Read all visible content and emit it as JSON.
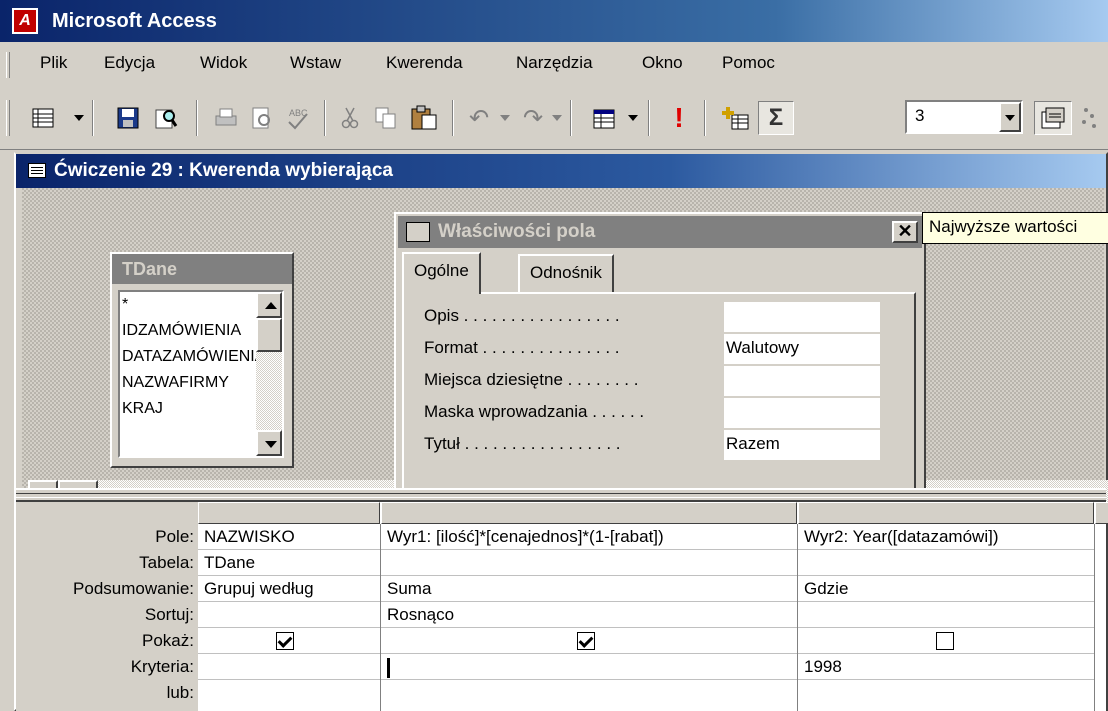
{
  "app": {
    "title": "Microsoft Access",
    "icon": "access-key-icon"
  },
  "menu": [
    "Plik",
    "Edycja",
    "Widok",
    "Wstaw",
    "Kwerenda",
    "Narzędzia",
    "Okno",
    "Pomoc"
  ],
  "toolbar": {
    "top_values_value": "3",
    "icons": [
      "view-icon",
      "save-icon",
      "search-icon",
      "print-icon",
      "print-preview-icon",
      "spelling-icon",
      "cut-icon",
      "copy-icon",
      "paste-icon",
      "undo-icon",
      "redo-icon",
      "query-type-icon",
      "run-icon",
      "show-table-icon",
      "totals-icon",
      "properties-icon"
    ],
    "totals_symbol": "Σ",
    "run_symbol": "!"
  },
  "tooltip": "Najwyższe wartości",
  "query_window": {
    "title": "Ćwiczenie 29 : Kwerenda wybierająca",
    "table": {
      "name": "TDane",
      "fields": [
        "*",
        "IDZAMÓWIENIA",
        "DATAZAMÓWIENIA",
        "NAZWAFIRMY",
        "KRAJ"
      ]
    }
  },
  "properties": {
    "title": "Właściwości pola",
    "close": "✕",
    "tabs": [
      "Ogólne",
      "Odnośnik"
    ],
    "rows": [
      {
        "label": "Opis . . . . . . . . . . . . . . . . .",
        "value": ""
      },
      {
        "label": "Format . . . . . . . . . . . . . . .",
        "value": "Walutowy"
      },
      {
        "label": "Miejsca dziesiętne . . . . . . . .",
        "value": ""
      },
      {
        "label": "Maska wprowadzania . . . . . .",
        "value": ""
      },
      {
        "label": "Tytuł . . . . . . . . . . . . . . . . .",
        "value": "Razem"
      }
    ]
  },
  "grid": {
    "row_labels": [
      "Pole:",
      "Tabela:",
      "Podsumowanie:",
      "Sortuj:",
      "Pokaż:",
      "Kryteria:",
      "lub:"
    ],
    "columns": [
      {
        "pole": "NAZWISKO",
        "tabela": "TDane",
        "podsumowanie": "Grupuj według",
        "sortuj": "",
        "pokaz": true,
        "kryteria": "",
        "lub": ""
      },
      {
        "pole": "Wyr1: [ilość]*[cenajednos]*(1-[rabat])",
        "tabela": "",
        "podsumowanie": "Suma",
        "sortuj": "Rosnąco",
        "pokaz": true,
        "kryteria": "",
        "lub": ""
      },
      {
        "pole": "Wyr2: Year([datazamówi])",
        "tabela": "",
        "podsumowanie": "Gdzie",
        "sortuj": "",
        "pokaz": false,
        "kryteria": "1998",
        "lub": ""
      }
    ]
  }
}
